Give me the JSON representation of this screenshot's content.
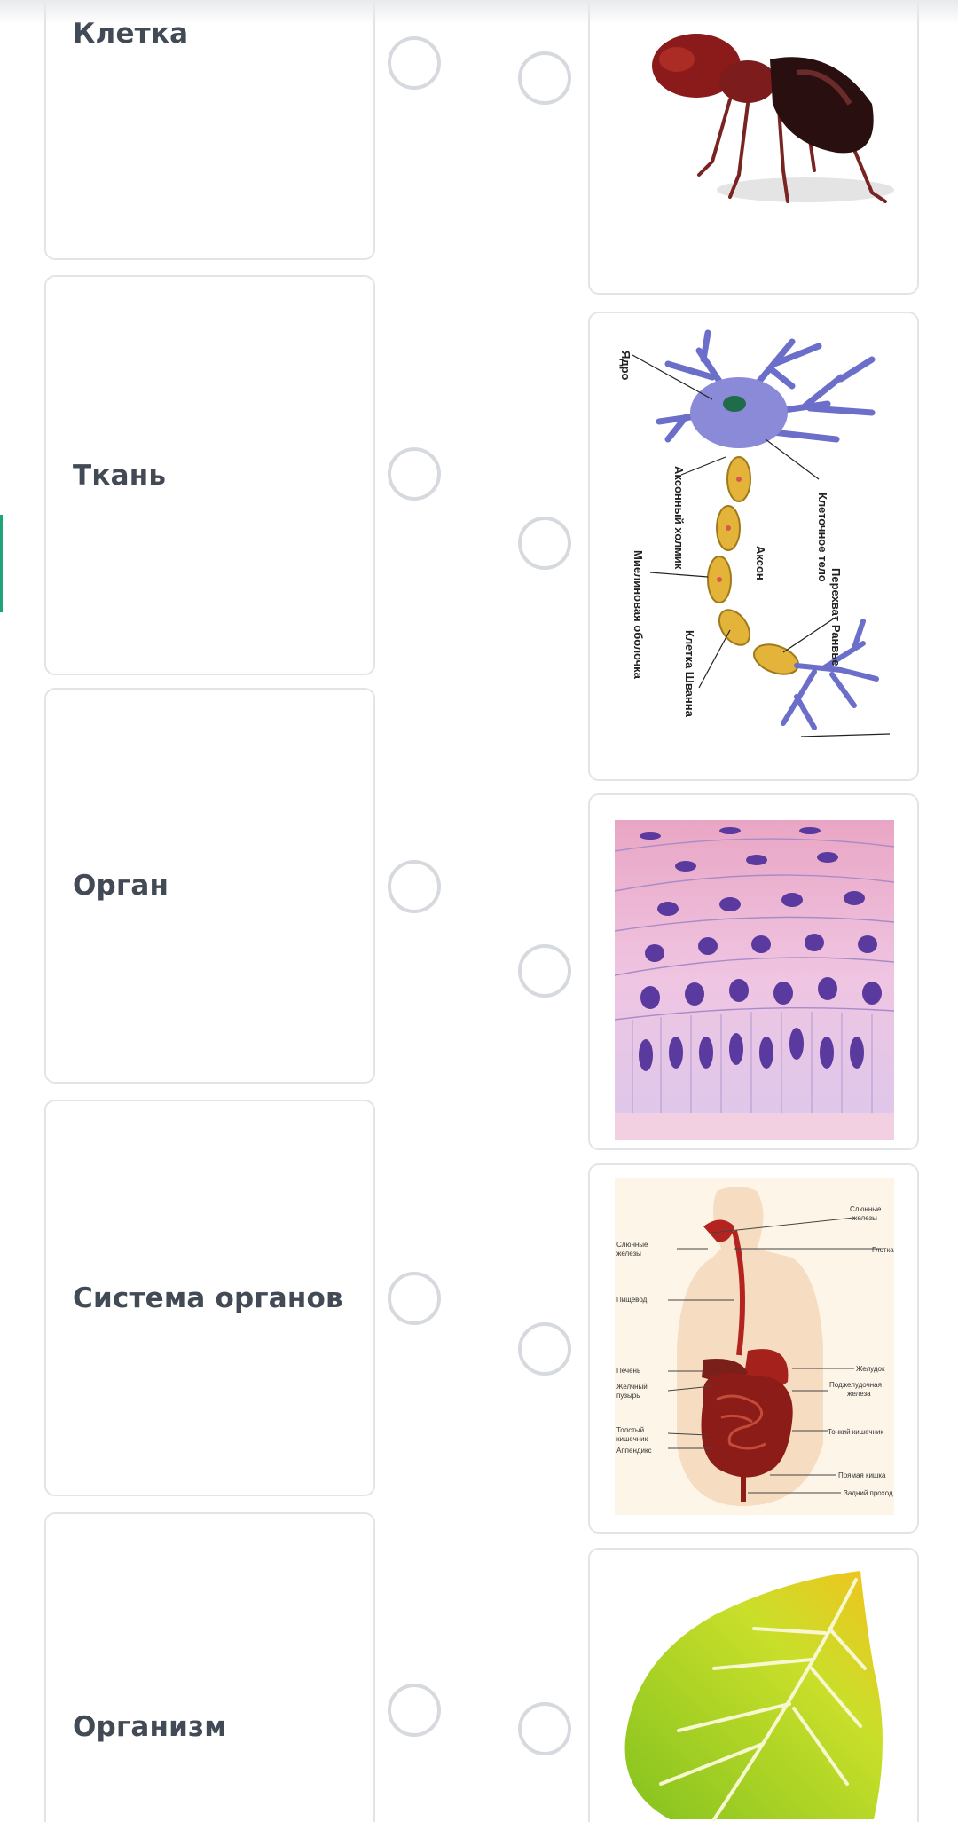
{
  "terms": [
    {
      "label": "Клетка"
    },
    {
      "label": "Ткань"
    },
    {
      "label": "Орган"
    },
    {
      "label": "Система органов"
    },
    {
      "label": "Организм"
    }
  ],
  "images": [
    {
      "icon": "ant-image"
    },
    {
      "icon": "neuron-diagram-image",
      "labels": [
        "Ядро",
        "Аксонный холмик",
        "Клеточное тело",
        "Миелиновая оболочка",
        "Аксон",
        "Перехват Ранвье",
        "Клетка Шванна"
      ]
    },
    {
      "icon": "epithelial-tissue-image"
    },
    {
      "icon": "digestive-system-image",
      "labels": [
        "Слюнные железы",
        "Глотка",
        "Слюнные железы",
        "Пищевод",
        "Желудок",
        "Печень",
        "Желчный пузырь",
        "Поджелудочная железа",
        "Толстый кишечник",
        "Тонкий кишечник",
        "Аппендикс",
        "Прямая кишка",
        "Задний проход"
      ]
    },
    {
      "icon": "leaf-image"
    }
  ],
  "colors": {
    "border": "#e3e4e7",
    "radio_border": "#d6d9dd",
    "text": "#414a55",
    "accent": "#1fa37a"
  }
}
